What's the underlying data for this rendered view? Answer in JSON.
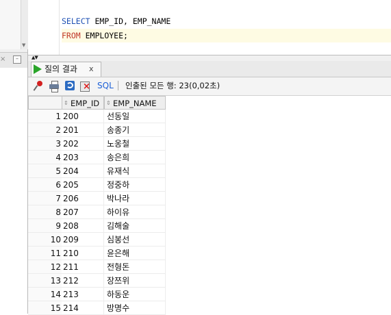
{
  "editor": {
    "line1": {
      "keyword": "SELECT",
      "rest": " EMP_ID, EMP_NAME"
    },
    "line2": {
      "keyword": "FROM",
      "rest": " EMPLOYEE;"
    }
  },
  "results_tab": {
    "label": "질의 결과",
    "close": "x"
  },
  "toolbar": {
    "sql_label": "SQL",
    "separator": "|",
    "status": "인출된 모든 행: 23(0,02초)"
  },
  "left_panel": {
    "close_glyph": "×",
    "minimize_glyph": "–"
  },
  "grid": {
    "columns": [
      "EMP_ID",
      "EMP_NAME"
    ],
    "rows": [
      {
        "n": "1",
        "id": "200",
        "name": "선동일"
      },
      {
        "n": "2",
        "id": "201",
        "name": "송종기"
      },
      {
        "n": "3",
        "id": "202",
        "name": "노옹철"
      },
      {
        "n": "4",
        "id": "203",
        "name": "송은희"
      },
      {
        "n": "5",
        "id": "204",
        "name": "유재식"
      },
      {
        "n": "6",
        "id": "205",
        "name": "정중하"
      },
      {
        "n": "7",
        "id": "206",
        "name": "박나라"
      },
      {
        "n": "8",
        "id": "207",
        "name": "하이유"
      },
      {
        "n": "9",
        "id": "208",
        "name": "김해술"
      },
      {
        "n": "10",
        "id": "209",
        "name": "심봉선"
      },
      {
        "n": "11",
        "id": "210",
        "name": "윤은해"
      },
      {
        "n": "12",
        "id": "211",
        "name": "전형돈"
      },
      {
        "n": "13",
        "id": "212",
        "name": "장쯔위"
      },
      {
        "n": "14",
        "id": "213",
        "name": "하동운"
      },
      {
        "n": "15",
        "id": "214",
        "name": "방명수"
      }
    ]
  },
  "colors": {
    "keyword": "#1c4fb3",
    "keyword_from": "#c0382a",
    "play": "#2aa52a",
    "sql_link": "#1b5fd6",
    "current_line": "#fefbe3"
  }
}
